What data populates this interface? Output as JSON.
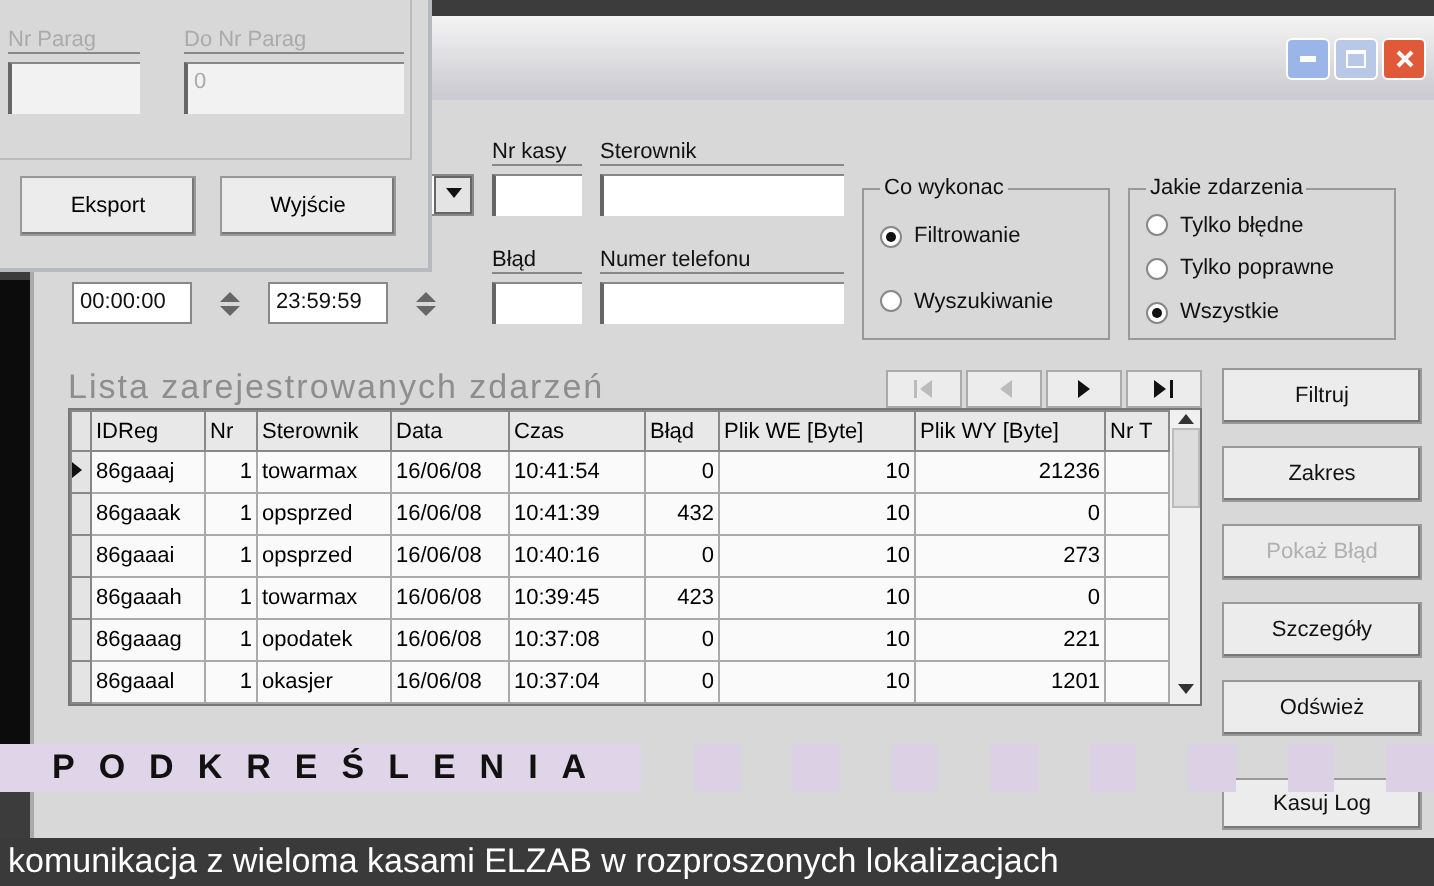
{
  "back_window": {
    "fields": [
      {
        "label": "Nr Parag",
        "disabled": true
      },
      {
        "label": "Do Nr Parag",
        "value": "0",
        "disabled": true
      }
    ],
    "buttons": [
      "Eksport",
      "Wyjście"
    ]
  },
  "main_window": {
    "filters": {
      "nr_kasy": {
        "label": "Nr kasy"
      },
      "sterownik": {
        "label": "Sterownik"
      },
      "blad": {
        "label": "Błąd"
      },
      "numer_telefonu": {
        "label": "Numer telefonu"
      },
      "time_from": "00:00:00",
      "time_to": "23:59:59"
    },
    "groups": [
      {
        "title": "Co wykonac",
        "options": [
          {
            "label": "Filtrowanie",
            "selected": true
          },
          {
            "label": "Wyszukiwanie",
            "selected": false
          }
        ]
      },
      {
        "title": "Jakie zdarzenia",
        "options": [
          {
            "label": "Tylko błędne",
            "selected": false
          },
          {
            "label": "Tylko poprawne",
            "selected": false
          },
          {
            "label": "Wszystkie",
            "selected": true
          }
        ]
      }
    ],
    "list_title": "Lista zarejestrowanych zdarzeń",
    "nav_buttons": [
      {
        "kind": "first",
        "disabled": true
      },
      {
        "kind": "prev",
        "disabled": true
      },
      {
        "kind": "next",
        "disabled": false
      },
      {
        "kind": "last",
        "disabled": false
      }
    ],
    "table": {
      "columns": [
        "IDReg",
        "Nr",
        "Sterownik",
        "Data",
        "Czas",
        "Błąd",
        "Plik WE [Byte]",
        "Plik WY [Byte]",
        "Nr T"
      ],
      "rows": [
        {
          "selected": true,
          "cells": [
            "86gaaaj",
            "1",
            "towarmax",
            "16/06/08",
            "10:41:54",
            "0",
            "10",
            "21236",
            ""
          ]
        },
        {
          "selected": false,
          "cells": [
            "86gaaak",
            "1",
            "opsprzed",
            "16/06/08",
            "10:41:39",
            "432",
            "10",
            "0",
            ""
          ]
        },
        {
          "selected": false,
          "cells": [
            "86gaaai",
            "1",
            "opsprzed",
            "16/06/08",
            "10:40:16",
            "0",
            "10",
            "273",
            ""
          ]
        },
        {
          "selected": false,
          "cells": [
            "86gaaah",
            "1",
            "towarmax",
            "16/06/08",
            "10:39:45",
            "423",
            "10",
            "0",
            ""
          ]
        },
        {
          "selected": false,
          "cells": [
            "86gaaag",
            "1",
            "opodatek",
            "16/06/08",
            "10:37:08",
            "0",
            "10",
            "221",
            ""
          ]
        },
        {
          "selected": false,
          "cells": [
            "86gaaal",
            "1",
            "okasjer",
            "16/06/08",
            "10:37:04",
            "0",
            "10",
            "1201",
            ""
          ]
        }
      ]
    },
    "side_buttons": [
      {
        "label": "Filtruj",
        "disabled": false
      },
      {
        "label": "Zakres",
        "disabled": false
      },
      {
        "label": "Pokaż Błąd",
        "disabled": true
      },
      {
        "label": "Szczegóły",
        "disabled": false
      },
      {
        "label": "Odśwież",
        "disabled": false
      },
      {
        "label": "Kasuj Log",
        "disabled": false
      }
    ]
  },
  "banner": {
    "title": "PODKREŚLENIA"
  },
  "caption": "komunikacja z wieloma kasami ELZAB w rozproszonych lokalizacjach"
}
